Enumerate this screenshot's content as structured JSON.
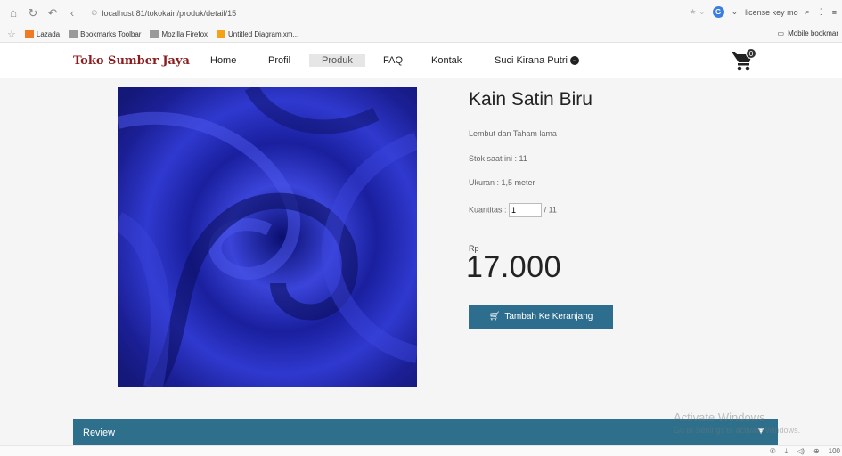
{
  "browser": {
    "url": "localhost:81/tokokain/produk/detail/15",
    "search_text": "license key mo",
    "bookmarks": [
      "Lazada",
      "Bookmarks Toolbar",
      "Mozilla Firefox",
      "Untitled Diagram.xm..."
    ],
    "mobile_bookmarks": "Mobile bookmar",
    "zoom": "100"
  },
  "site": {
    "brand": "Toko Sumber Jaya",
    "menu": [
      "Home",
      "Profil",
      "Produk",
      "FAQ",
      "Kontak"
    ],
    "user_name": "Suci Kirana Putri",
    "cart_count": "0"
  },
  "product": {
    "title": "Kain Satin Biru",
    "description": "Lembut dan Taham lama",
    "stock": "Stok saat ini : 11",
    "size": "Ukuran : 1,5 meter",
    "qty_label": "Kuantitas :",
    "qty_value": "1",
    "qty_max": "/ 11",
    "currency": "Rp",
    "price": "17.000",
    "add_button": "Tambah Ke Keranjang"
  },
  "review": {
    "label": "Review"
  },
  "watermark": {
    "line1": "Activate Windows",
    "line2": "Go to Settings to activate Windows."
  },
  "colors": {
    "accent": "#2d6e8e",
    "brand": "#8a1c1c",
    "fabric": "#2a2fb8"
  }
}
